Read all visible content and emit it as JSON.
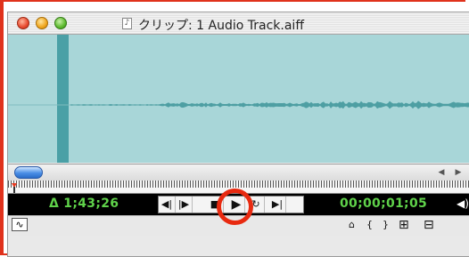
{
  "window": {
    "title": "クリップ: 1 Audio Track.aiff",
    "doc_icon": "♪"
  },
  "colors": {
    "waveform_bg": "#a8d6d8",
    "waveform": "#3a8e92",
    "timecode": "#5fd24a",
    "highlight": "#e82a10"
  },
  "transport": {
    "duration_timecode": "Δ 1;43;26",
    "current_timecode": "00;00;01;05",
    "buttons": [
      {
        "name": "step-back-button",
        "glyph": "◀|"
      },
      {
        "name": "step-forward-button",
        "glyph": "|▶"
      },
      {
        "name": "stop-button",
        "glyph": "■"
      },
      {
        "name": "play-button",
        "glyph": "▶"
      },
      {
        "name": "loop-button",
        "glyph": "↻"
      },
      {
        "name": "go-to-out-button",
        "glyph": "▶|"
      }
    ]
  },
  "scrollbar": {
    "left_arrow": "◀",
    "right_arrow": "▶"
  },
  "bottom_tools": {
    "waveform_toggle": "∿",
    "set_in": "⌂",
    "mark_in": "{",
    "mark_out": "}",
    "insert": "⊞",
    "overlay": "⊟"
  },
  "icons": [
    "close-icon",
    "minimize-icon",
    "zoom-icon",
    "audio-file-icon",
    "speaker-icon",
    "waveform-icon"
  ]
}
